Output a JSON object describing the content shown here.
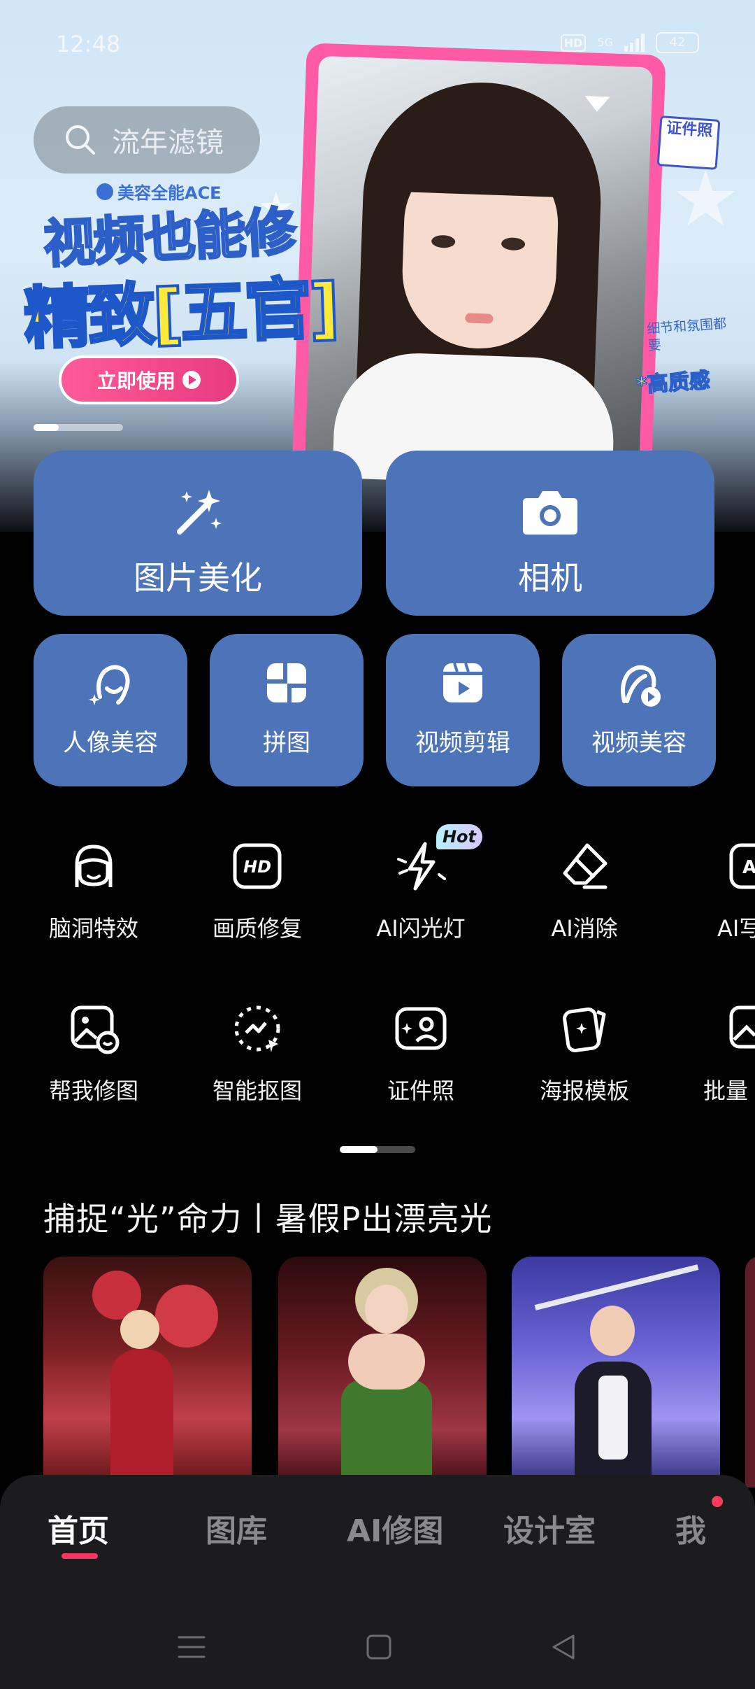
{
  "status_bar": {
    "time": "12:48",
    "hd": "HD",
    "network": "5G",
    "battery": "42"
  },
  "banner": {
    "search_placeholder": "流年滤镜",
    "brand": "美容全能ACE",
    "headline_line1": "视频也能修",
    "headline_line2": "精致[五官]",
    "cta_label": "立即使用",
    "badge": "证件照",
    "side_note": "细节和氛围都要",
    "side_note_highlight": "*高质感"
  },
  "main_tiles": [
    {
      "label": "图片美化",
      "icon": "magic-wand-icon"
    },
    {
      "label": "相机",
      "icon": "camera-icon"
    }
  ],
  "small_tiles": [
    {
      "label": "人像美容",
      "icon": "portrait-sparkle-icon"
    },
    {
      "label": "拼图",
      "icon": "collage-icon"
    },
    {
      "label": "视频剪辑",
      "icon": "video-edit-icon"
    },
    {
      "label": "视频美容",
      "icon": "video-beauty-icon"
    }
  ],
  "tools_row1": [
    {
      "label": "脑洞特效",
      "icon": "face-effect-icon"
    },
    {
      "label": "画质修复",
      "icon": "hd-repair-icon"
    },
    {
      "label": "AI闪光灯",
      "icon": "flash-icon",
      "badge": "Hot"
    },
    {
      "label": "AI消除",
      "icon": "eraser-icon"
    },
    {
      "label": "AI写",
      "icon": "ai-write-icon"
    }
  ],
  "tools_row2": [
    {
      "label": "帮我修图",
      "icon": "photo-help-icon"
    },
    {
      "label": "智能抠图",
      "icon": "smart-cutout-icon"
    },
    {
      "label": "证件照",
      "icon": "id-photo-icon"
    },
    {
      "label": "海报模板",
      "icon": "poster-template-icon"
    },
    {
      "label": "批量",
      "icon": "batch-edit-icon"
    }
  ],
  "section": {
    "title": "捕捉“光”命力丨暑假P出漂亮光"
  },
  "bottom_nav": [
    {
      "label": "首页",
      "active": true
    },
    {
      "label": "图库",
      "active": false
    },
    {
      "label": "AI修图",
      "active": false
    },
    {
      "label": "设计室",
      "active": false
    },
    {
      "label": "我",
      "active": false
    }
  ],
  "colors": {
    "tile_blue": "#4d74b8",
    "accent_pink": "#ff3366",
    "background": "#000000"
  }
}
